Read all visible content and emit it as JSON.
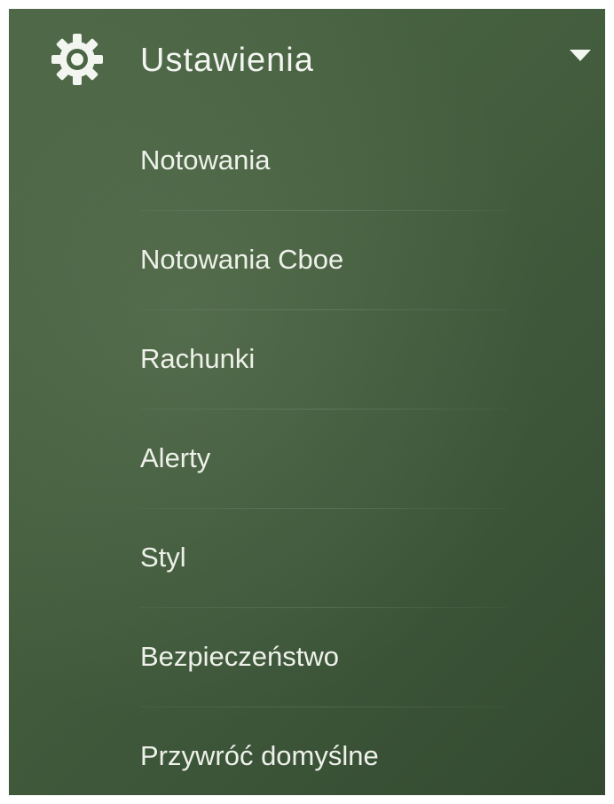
{
  "header": {
    "title": "Ustawienia",
    "icon": "gear-icon",
    "expand_icon": "caret-down-icon"
  },
  "menu": {
    "items": [
      {
        "label": "Notowania"
      },
      {
        "label": "Notowania Cboe"
      },
      {
        "label": "Rachunki"
      },
      {
        "label": "Alerty"
      },
      {
        "label": "Styl"
      },
      {
        "label": "Bezpieczeństwo"
      },
      {
        "label": "Przywróć domyślne"
      }
    ]
  },
  "colors": {
    "panel_background": "#45603f",
    "text": "#eef1ea",
    "icon": "#f3f5f0"
  }
}
